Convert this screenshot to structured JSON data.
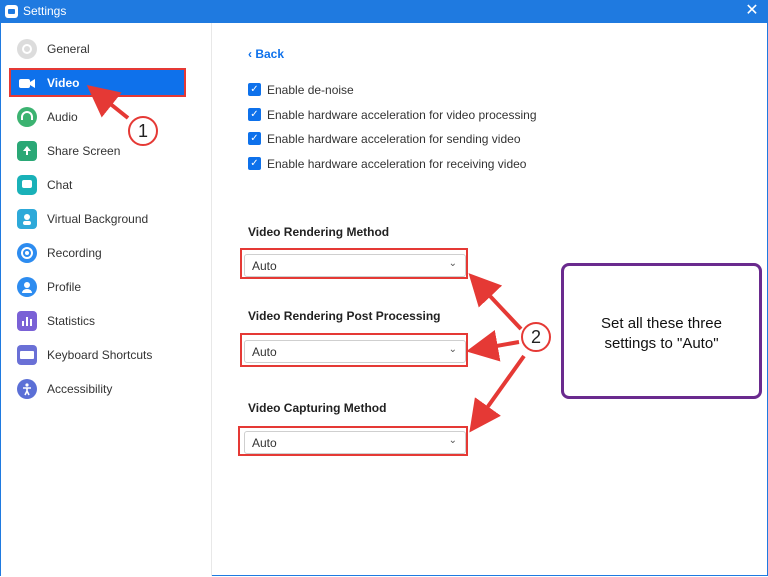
{
  "window": {
    "title": "Settings"
  },
  "sidebar": {
    "items": [
      {
        "label": "General",
        "icon": "gear-icon",
        "color": "#d6d6d6"
      },
      {
        "label": "Video",
        "icon": "video-camera-icon",
        "color": "#ffffff"
      },
      {
        "label": "Audio",
        "icon": "headphones-icon",
        "color": "#3cb371"
      },
      {
        "label": "Share Screen",
        "icon": "share-screen-icon",
        "color": "#2aa876"
      },
      {
        "label": "Chat",
        "icon": "chat-bubble-icon",
        "color": "#19b1b8"
      },
      {
        "label": "Virtual Background",
        "icon": "person-background-icon",
        "color": "#2da9d9"
      },
      {
        "label": "Recording",
        "icon": "record-icon",
        "color": "#2d8cf0"
      },
      {
        "label": "Profile",
        "icon": "person-icon",
        "color": "#2d8cf0"
      },
      {
        "label": "Statistics",
        "icon": "bar-chart-icon",
        "color": "#7a61d6"
      },
      {
        "label": "Keyboard Shortcuts",
        "icon": "keyboard-icon",
        "color": "#6a70d6"
      },
      {
        "label": "Accessibility",
        "icon": "accessibility-icon",
        "color": "#5b6fd6"
      }
    ],
    "active": "Video"
  },
  "main": {
    "back_label": "Back",
    "checkboxes": [
      {
        "label": "Enable de-noise",
        "checked": true
      },
      {
        "label": "Enable hardware acceleration for video processing",
        "checked": true
      },
      {
        "label": "Enable hardware acceleration for sending video",
        "checked": true
      },
      {
        "label": "Enable hardware acceleration for receiving video",
        "checked": true
      }
    ],
    "sections": [
      {
        "title": "Video Rendering Method",
        "value": "Auto"
      },
      {
        "title": "Video Rendering Post Processing",
        "value": "Auto"
      },
      {
        "title": "Video Capturing Method",
        "value": "Auto"
      }
    ]
  },
  "annotations": {
    "callout1": "1",
    "callout2": "2",
    "note": "Set all these three settings to \"Auto\"",
    "highlight_color": "#e53935",
    "note_border_color": "#6a2a8e"
  },
  "colors": {
    "accent": "#0e71eb",
    "titlebar": "#1f7ae0"
  }
}
